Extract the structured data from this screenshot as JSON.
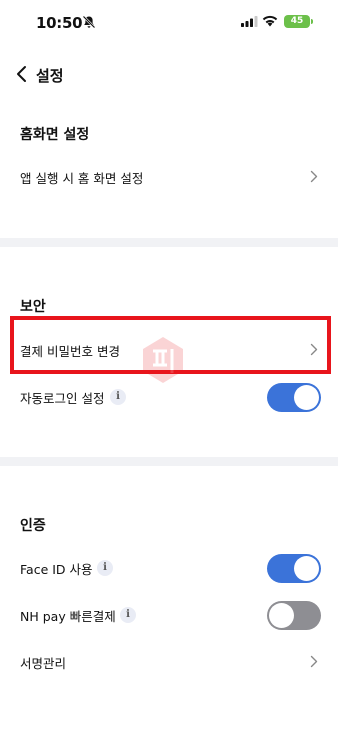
{
  "status_bar": {
    "time": "10:50",
    "battery": "45"
  },
  "nav": {
    "back_label": "back",
    "title": "설정"
  },
  "sections": [
    {
      "title": "홈화면 설정",
      "items": [
        {
          "label": "앱 실행 시 홈 화면 설정",
          "type": "link"
        }
      ]
    },
    {
      "title": "보안",
      "items": [
        {
          "label": "결제 비밀번호 변경",
          "type": "link"
        },
        {
          "label": "자동로그인 설정",
          "type": "toggle",
          "info": true,
          "on": true
        }
      ]
    },
    {
      "title": "인증",
      "items": [
        {
          "label": "Face ID 사용",
          "type": "toggle",
          "info": true,
          "on": true
        },
        {
          "label": "NH pay 빠른결제",
          "type": "toggle",
          "info": true,
          "on": false
        },
        {
          "label": "서명관리",
          "type": "link"
        }
      ]
    }
  ],
  "colors": {
    "toggle_on": "#3b73d9",
    "toggle_off": "#8e8e93",
    "highlight": "#e8151c",
    "divider": "#f1f2f5"
  },
  "icons": {
    "back": "chevron-left-icon",
    "chevron": "chevron-right-icon",
    "info": "info-icon",
    "mute": "bell-slash-icon"
  }
}
